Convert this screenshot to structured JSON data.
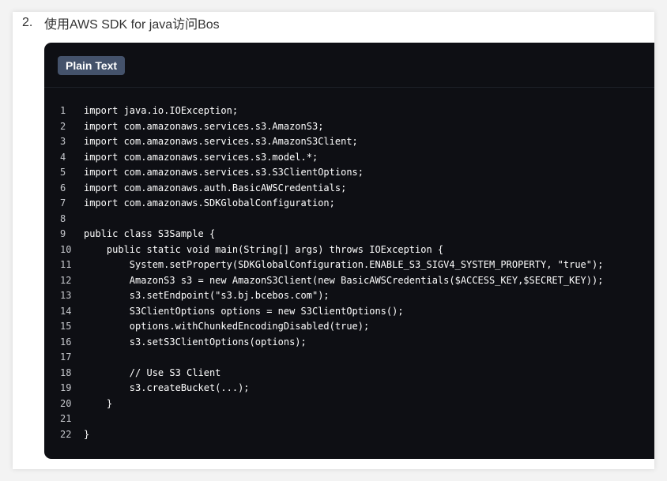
{
  "step": {
    "number": "2.",
    "title": "使用AWS SDK for java访问Bos"
  },
  "code_block": {
    "language_label": "Plain Text",
    "lines": [
      {
        "no": "1",
        "text": "import java.io.IOException;"
      },
      {
        "no": "2",
        "text": "import com.amazonaws.services.s3.AmazonS3;"
      },
      {
        "no": "3",
        "text": "import com.amazonaws.services.s3.AmazonS3Client;"
      },
      {
        "no": "4",
        "text": "import com.amazonaws.services.s3.model.*;"
      },
      {
        "no": "5",
        "text": "import com.amazonaws.services.s3.S3ClientOptions;"
      },
      {
        "no": "6",
        "text": "import com.amazonaws.auth.BasicAWSCredentials;"
      },
      {
        "no": "7",
        "text": "import com.amazonaws.SDKGlobalConfiguration;"
      },
      {
        "no": "8",
        "text": ""
      },
      {
        "no": "9",
        "text": "public class S3Sample {"
      },
      {
        "no": "10",
        "text": "    public static void main(String[] args) throws IOException {"
      },
      {
        "no": "11",
        "text": "        System.setProperty(SDKGlobalConfiguration.ENABLE_S3_SIGV4_SYSTEM_PROPERTY, \"true\");"
      },
      {
        "no": "12",
        "text": "        AmazonS3 s3 = new AmazonS3Client(new BasicAWSCredentials($ACCESS_KEY,$SECRET_KEY));"
      },
      {
        "no": "13",
        "text": "        s3.setEndpoint(\"s3.bj.bcebos.com\");"
      },
      {
        "no": "14",
        "text": "        S3ClientOptions options = new S3ClientOptions();"
      },
      {
        "no": "15",
        "text": "        options.withChunkedEncodingDisabled(true);"
      },
      {
        "no": "16",
        "text": "        s3.setS3ClientOptions(options);"
      },
      {
        "no": "17",
        "text": ""
      },
      {
        "no": "18",
        "text": "        // Use S3 Client"
      },
      {
        "no": "19",
        "text": "        s3.createBucket(...);"
      },
      {
        "no": "20",
        "text": "    }"
      },
      {
        "no": "21",
        "text": ""
      },
      {
        "no": "22",
        "text": "}"
      }
    ]
  },
  "colors": {
    "page_background": "#f3f3f3",
    "card_background": "#ffffff",
    "code_background": "#0e0f14",
    "badge_background": "#44526b",
    "code_text": "#ffffff",
    "line_number_text": "#c5c7cc"
  }
}
